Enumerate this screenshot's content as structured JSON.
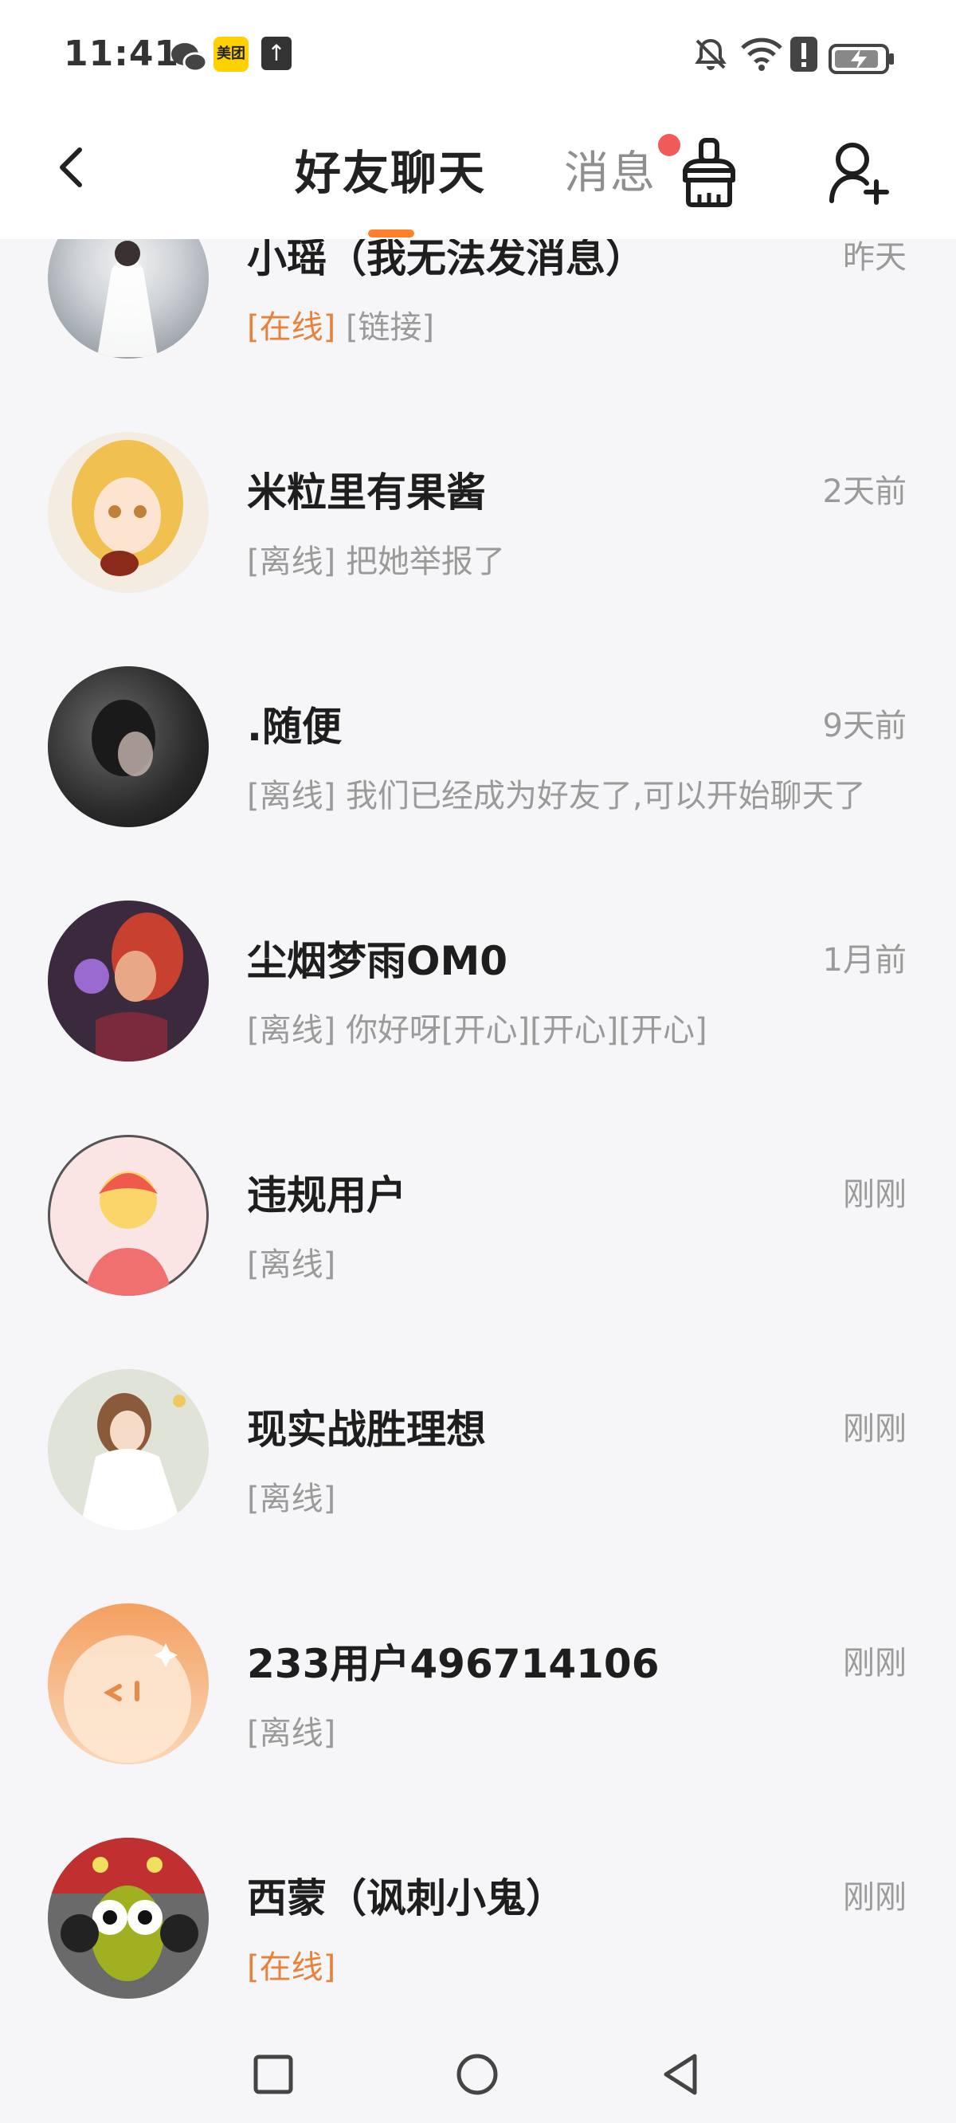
{
  "status_bar": {
    "time": "11:41",
    "meituan_label": "美团"
  },
  "header": {
    "tab_chat": "好友聊天",
    "tab_messages": "消息"
  },
  "chats": [
    {
      "name": "小瑶（我无法发消息）",
      "time": "昨天",
      "status": "[在线]",
      "online": true,
      "message": "[链接]"
    },
    {
      "name": "米粒里有果酱",
      "time": "2天前",
      "status": "[离线]",
      "online": false,
      "message": "把她举报了"
    },
    {
      "name": ".随便",
      "time": "9天前",
      "status": "[离线]",
      "online": false,
      "message": "我们已经成为好友了,可以开始聊天了"
    },
    {
      "name": "尘烟梦雨OM0",
      "time": "1月前",
      "status": "[离线]",
      "online": false,
      "message": "你好呀[开心][开心][开心]"
    },
    {
      "name": "违规用户",
      "time": "刚刚",
      "status": "[离线]",
      "online": false,
      "message": ""
    },
    {
      "name": "现实战胜理想",
      "time": "刚刚",
      "status": "[离线]",
      "online": false,
      "message": ""
    },
    {
      "name": "233用户496714106",
      "time": "刚刚",
      "status": "[离线]",
      "online": false,
      "message": ""
    },
    {
      "name": "西蒙（讽刺小鬼）",
      "time": "刚刚",
      "status": "[在线]",
      "online": true,
      "message": ""
    }
  ],
  "colors": {
    "accent": "#ff7f2a",
    "online": "#e8823a",
    "badge_red": "#f25a5a"
  }
}
